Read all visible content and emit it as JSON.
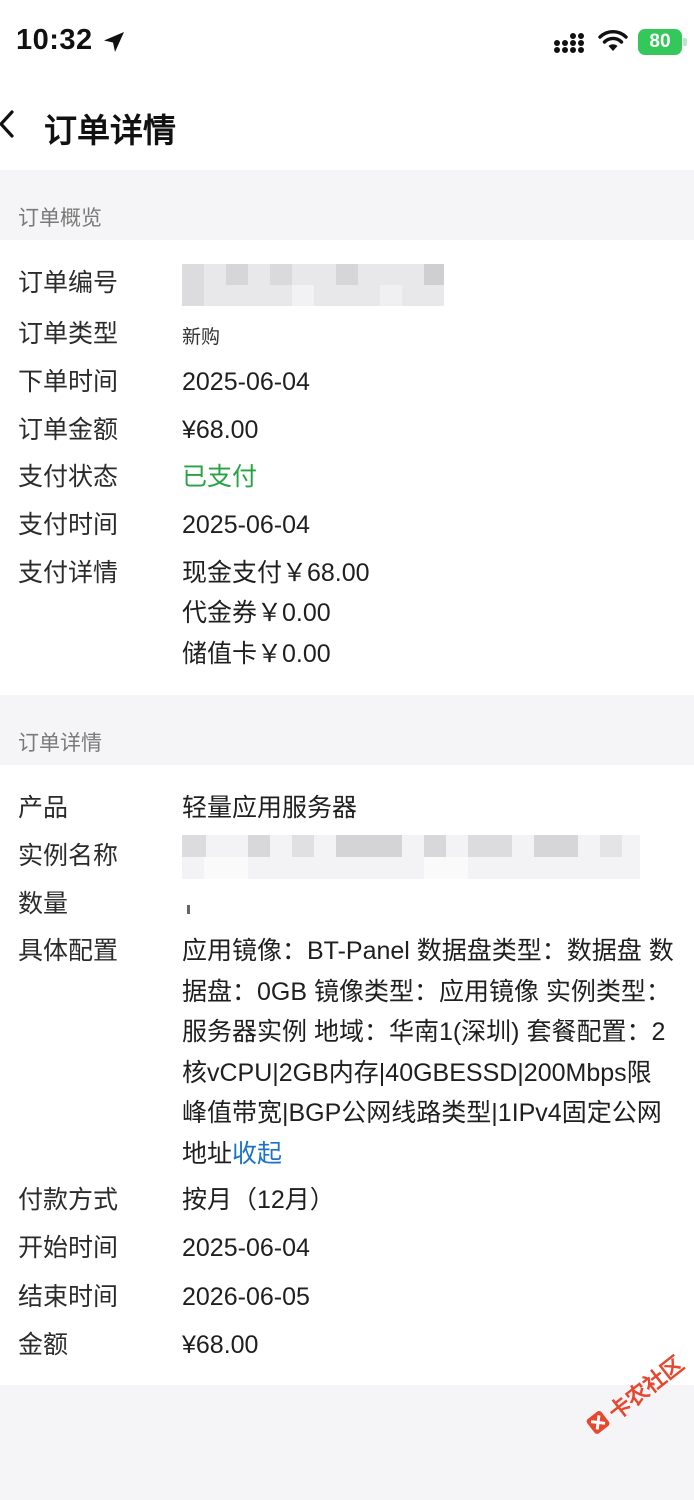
{
  "status_bar": {
    "time": "10:32",
    "battery": "80"
  },
  "nav": {
    "title": "订单详情"
  },
  "overview": {
    "header": "订单概览",
    "rows": [
      {
        "label": "订单编号",
        "value": ""
      },
      {
        "label": "订单类型",
        "value": "新购"
      },
      {
        "label": "下单时间",
        "value": "2025-06-04"
      },
      {
        "label": "订单金额",
        "value": "¥68.00"
      },
      {
        "label": "支付状态",
        "value": "已支付"
      },
      {
        "label": "支付时间",
        "value": "2025-06-04"
      },
      {
        "label": "支付详情",
        "value": "现金支付￥68.00"
      }
    ],
    "payment_extra": [
      "代金券￥0.00",
      "储值卡￥0.00"
    ]
  },
  "details": {
    "header": "订单详情",
    "rows": [
      {
        "label": "产品",
        "value": "轻量应用服务器"
      },
      {
        "label": "实例名称",
        "value": ""
      },
      {
        "label": "数量",
        "value": ""
      },
      {
        "label": "具体配置",
        "value": "应用镜像：BT-Panel 数据盘类型：数据盘 数据盘：0GB 镜像类型：应用镜像 实例类型：服务器实例 地域：华南1(深圳) 套餐配置：2核vCPU|2GB内存|40GBESSD|200Mbps限峰值带宽|BGP公网线路类型|1IPv4固定公网地址"
      },
      {
        "label": "付款方式",
        "value": "按月（12月）"
      },
      {
        "label": "开始时间",
        "value": "2025-06-04"
      },
      {
        "label": "结束时间",
        "value": "2026-06-05"
      },
      {
        "label": "金额",
        "value": "¥68.00"
      }
    ],
    "collapse_link": "收起"
  },
  "watermark": {
    "text": "卡农社区"
  },
  "colors": {
    "paid_green": "#27a244",
    "link_blue": "#1a73c8",
    "battery_green": "#34c759"
  }
}
